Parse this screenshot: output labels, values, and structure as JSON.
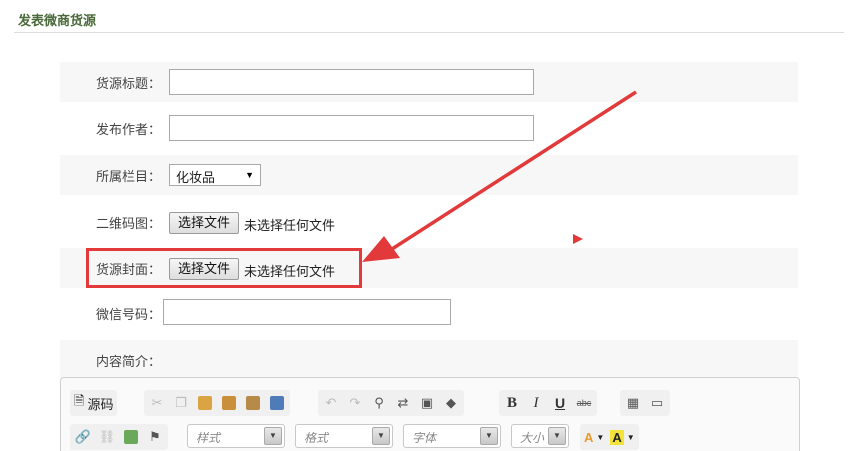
{
  "page": {
    "title": "发表微商货源"
  },
  "form": {
    "title_label": "货源标题：",
    "title_value": "",
    "author_label": "发布作者：",
    "author_value": "",
    "category_label": "所属栏目：",
    "category_selected": "化妆品",
    "qrcode_label": "二维码图：",
    "qrcode_button": "选择文件",
    "qrcode_status": "未选择任何文件",
    "cover_label": "货源封面：",
    "cover_button": "选择文件",
    "cover_status": "未选择任何文件",
    "wechat_label": "微信号码：",
    "wechat_value": "",
    "intro_label": "内容简介："
  },
  "editor": {
    "source_label": "源码",
    "style_placeholder": "样式",
    "format_placeholder": "格式",
    "font_placeholder": "字体",
    "size_placeholder": "大小",
    "bold_label": "B",
    "italic_label": "I",
    "underline_label": "U",
    "strike_label": "abc",
    "text_color_label": "A",
    "bg_color_label": "A"
  },
  "colors": {
    "highlight": "#e23a3a",
    "title_text": "#4a6a3a"
  }
}
